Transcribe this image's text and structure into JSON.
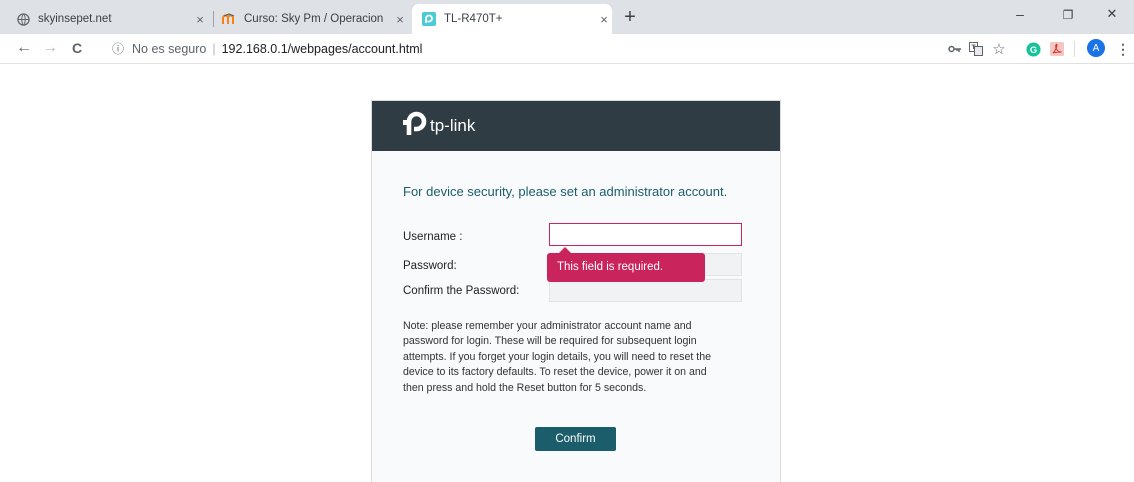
{
  "browser": {
    "tabs": [
      {
        "title": "skyinsepet.net",
        "icon": "globe-icon"
      },
      {
        "title": "Curso: Sky Pm / Operacion",
        "icon": "moodle-icon"
      },
      {
        "title": "TL-R470T+",
        "icon": "tp-link-icon"
      }
    ],
    "close_glyph": "×",
    "newtab_glyph": "+",
    "window_controls": {
      "minimize": "–",
      "restore": "❐",
      "close": "✕"
    },
    "nav": {
      "back": "←",
      "forward": "→",
      "reload": "C"
    },
    "address": {
      "info_glyph": "ⓘ",
      "security_text": "No es seguro",
      "separator": "|",
      "url": "192.168.0.1/webpages/account.html"
    },
    "extensions": {
      "profile_letter": "A",
      "more": "⋮"
    },
    "colors": {
      "tab_strip": "#dee1e6",
      "profile": "#1a73e8",
      "grammarly": "#15c39a"
    }
  },
  "router": {
    "brand": "tp-link",
    "heading": "For device security, please set an administrator account.",
    "form": {
      "username_label": "Username :",
      "password_label": "Password:",
      "confirm_label": "Confirm the Password:",
      "username_value": "",
      "password_value": "",
      "confirm_value": ""
    },
    "error_tooltip": "This field is required.",
    "note_lines": [
      "Note: please remember your administrator account name and",
      "password for login. These will be required for subsequent login",
      "attempts. If you forget your login details, you will need to reset the",
      "device to its factory defaults. To reset the device, power it on and",
      "then press and hold the Reset button for 5 seconds."
    ],
    "confirm_button": "Confirm",
    "colors": {
      "header": "#2f3c43",
      "accent": "#1b5d6b",
      "error": "#c9245b"
    }
  }
}
